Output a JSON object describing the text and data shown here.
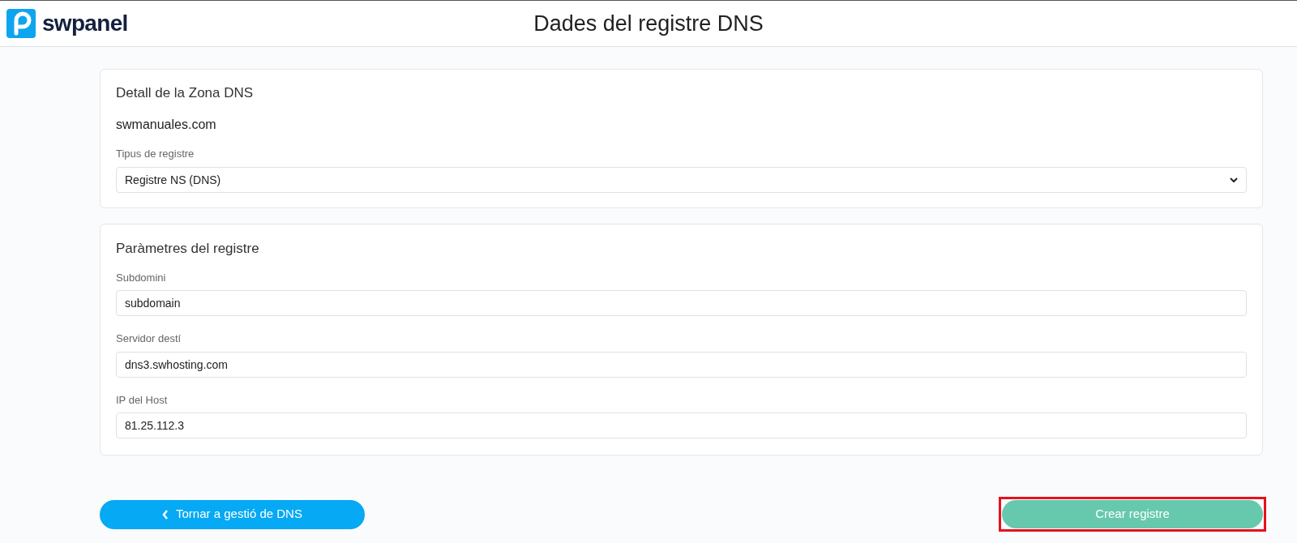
{
  "header": {
    "logo_text": "swpanel",
    "title": "Dades del registre DNS"
  },
  "zone_card": {
    "title": "Detall de la Zona DNS",
    "domain": "swmanuales.com",
    "type_label": "Tipus de registre",
    "type_value": "Registre NS (DNS)"
  },
  "params_card": {
    "title": "Paràmetres del registre",
    "fields": [
      {
        "label": "Subdomini",
        "value": "subdomain"
      },
      {
        "label": "Servidor destí",
        "value": "dns3.swhosting.com"
      },
      {
        "label": "IP del Host",
        "value": "81.25.112.3"
      }
    ]
  },
  "back_button": {
    "label": "Tornar a gestió de DNS"
  },
  "create_button": {
    "label": "Crear registre",
    "highlighted": true
  }
}
